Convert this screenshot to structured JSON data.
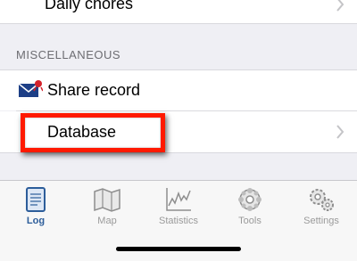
{
  "list": {
    "top_row_label": "Daily chores",
    "section_header": "MISCELLANEOUS",
    "share_record_label": "Share record",
    "database_label": "Database"
  },
  "tabbar": {
    "tabs": [
      {
        "label": "Log",
        "icon": "log-book-icon",
        "active": true
      },
      {
        "label": "Map",
        "icon": "map-icon",
        "active": false
      },
      {
        "label": "Statistics",
        "icon": "statistics-chart-icon",
        "active": false
      },
      {
        "label": "Tools",
        "icon": "tools-gear-icon",
        "active": false
      },
      {
        "label": "Settings",
        "icon": "settings-gears-icon",
        "active": false
      }
    ]
  },
  "colors": {
    "background": "#efeff4",
    "highlight": "#ff1a00",
    "active_tab": "#2c5d9a",
    "inactive_tab": "#9a9a9a"
  }
}
